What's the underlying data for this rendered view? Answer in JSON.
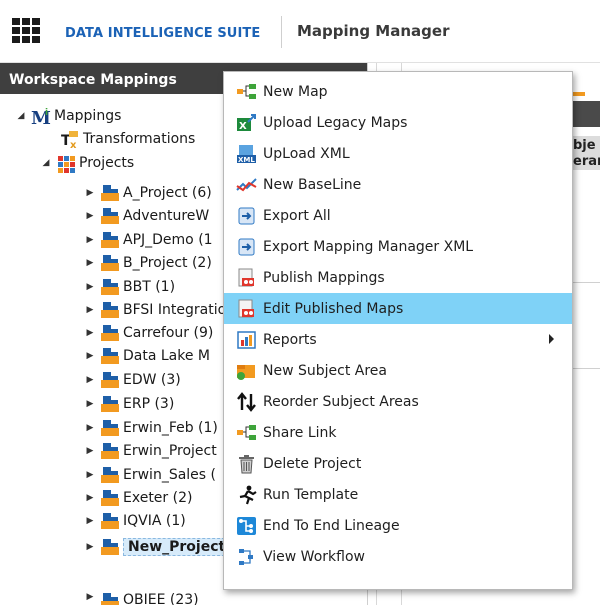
{
  "topbar": {
    "suite_name": "DATA INTELLIGENCE SUITE",
    "app_title": "Mapping Manager"
  },
  "panel": {
    "title": "Workspace Mappings"
  },
  "tree": {
    "root": "Mappings",
    "transformations": "Transformations",
    "projects": "Projects",
    "items": [
      "A_Project (6)",
      "AdventureW",
      "APJ_Demo (1",
      "B_Project (2)",
      "BBT (1)",
      "BFSI Integratio",
      "Carrefour (9)",
      "Data Lake M",
      "EDW (3)",
      "ERP (3)",
      "Erwin_Feb (1)",
      "Erwin_Project",
      "Erwin_Sales (",
      "Exeter (2)",
      "IQVIA (1)",
      "New_Project",
      "OBIEE (23)"
    ]
  },
  "context_menu": {
    "items": [
      {
        "label": "New Map",
        "icon": "new-map-icon"
      },
      {
        "label": "Upload Legacy Maps",
        "icon": "upload-legacy-icon"
      },
      {
        "label": "UpLoad XML",
        "icon": "xml-icon"
      },
      {
        "label": "New BaseLine",
        "icon": "baseline-icon"
      },
      {
        "label": "Export All",
        "icon": "export-icon"
      },
      {
        "label": "Export Mapping Manager XML",
        "icon": "export-xml-icon"
      },
      {
        "label": "Publish Mappings",
        "icon": "publish-icon"
      },
      {
        "label": "Edit Published Maps",
        "icon": "edit-published-icon"
      },
      {
        "label": "Reports",
        "icon": "reports-icon"
      },
      {
        "label": "New Subject Area",
        "icon": "subject-area-icon"
      },
      {
        "label": "Reorder Subject Areas",
        "icon": "reorder-icon"
      },
      {
        "label": "Share Link",
        "icon": "share-link-icon"
      },
      {
        "label": "Delete Project",
        "icon": "trash-icon"
      },
      {
        "label": "Run Template",
        "icon": "run-icon"
      },
      {
        "label": "End To End Lineage",
        "icon": "lineage-icon"
      },
      {
        "label": "View Workflow",
        "icon": "workflow-icon"
      }
    ],
    "highlighted": "Edit Published Maps"
  },
  "right_peek": {
    "line1": "bje",
    "line2": "erar"
  },
  "colors": {
    "brand_blue": "#1b62b6",
    "header_dark": "#3f3f3f",
    "menu_highlight": "#7fd2f7",
    "folder_orange": "#f29a20",
    "folder_blue": "#1e5fa8"
  }
}
